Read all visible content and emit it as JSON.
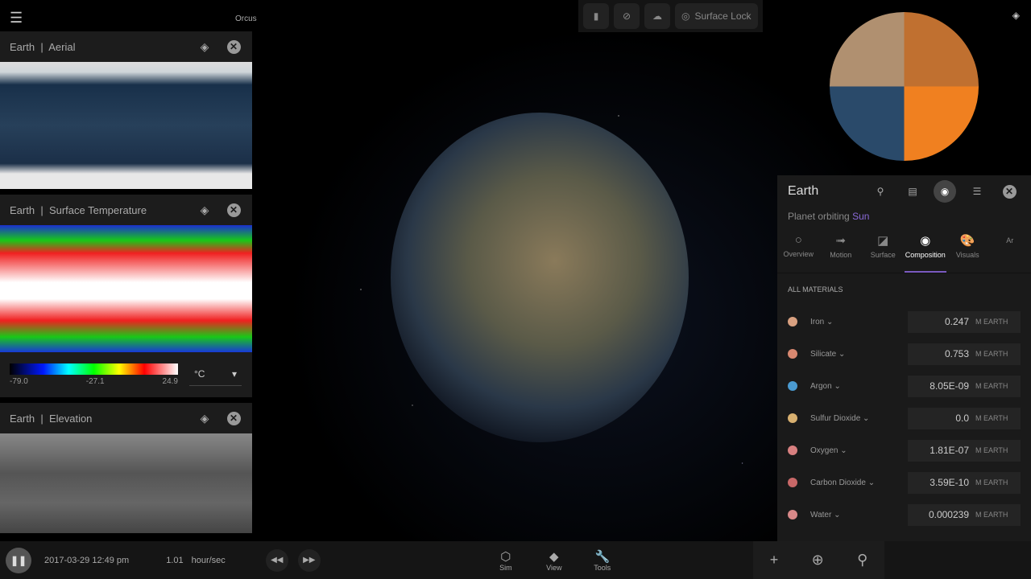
{
  "app": {
    "menu_icon": "hamburger-icon",
    "scene_label": "Orcus"
  },
  "left_panels": [
    {
      "object": "Earth",
      "separator": "|",
      "layer": "Aerial"
    },
    {
      "object": "Earth",
      "separator": "|",
      "layer": "Surface Temperature",
      "legend": {
        "min": "-79.0",
        "mid": "-27.1",
        "max": "24.9",
        "unit": "°C"
      }
    },
    {
      "object": "Earth",
      "separator": "|",
      "layer": "Elevation"
    }
  ],
  "top_toolbar": {
    "buttons": [
      {
        "icon": "flashlight-icon"
      },
      {
        "icon": "grid-off-icon"
      },
      {
        "icon": "cloud-off-icon"
      },
      {
        "icon": "surface-lock-icon",
        "label": "Surface Lock"
      }
    ]
  },
  "details": {
    "title": "Earth",
    "subtitle_prefix": "Planet orbiting",
    "subtitle_link": "Sun",
    "tabs": [
      {
        "label": "Overview",
        "icon": "○"
      },
      {
        "label": "Motion",
        "icon": "➟"
      },
      {
        "label": "Surface",
        "icon": "◪"
      },
      {
        "label": "Composition",
        "icon": "◉",
        "active": true
      },
      {
        "label": "Visuals",
        "icon": "🎨"
      },
      {
        "label": "Ar",
        "icon": ""
      }
    ],
    "section": "ALL MATERIALS",
    "materials": [
      {
        "name": "Iron",
        "value": "0.247",
        "unit": "M EARTH",
        "color": "#d8a080"
      },
      {
        "name": "Silicate",
        "value": "0.753",
        "unit": "M EARTH",
        "color": "#d88870"
      },
      {
        "name": "Argon",
        "value": "8.05E-09",
        "unit": "M EARTH",
        "color": "#4a9ad0"
      },
      {
        "name": "Sulfur Dioxide",
        "value": "0.0",
        "unit": "M EARTH",
        "color": "#d8b070"
      },
      {
        "name": "Oxygen",
        "value": "1.81E-07",
        "unit": "M EARTH",
        "color": "#d88080"
      },
      {
        "name": "Carbon Dioxide",
        "value": "3.59E-10",
        "unit": "M EARTH",
        "color": "#c86868"
      },
      {
        "name": "Water",
        "value": "0.000239",
        "unit": "M EARTH",
        "color": "#d88888"
      }
    ]
  },
  "bottom": {
    "date": "2017-03-29 12:49 pm",
    "rate": "1.01",
    "rate_unit": "hour/sec",
    "nav": [
      {
        "label": "Sim",
        "icon": "⬡"
      },
      {
        "label": "View",
        "icon": "◆"
      },
      {
        "label": "Tools",
        "icon": "🔧"
      }
    ]
  }
}
